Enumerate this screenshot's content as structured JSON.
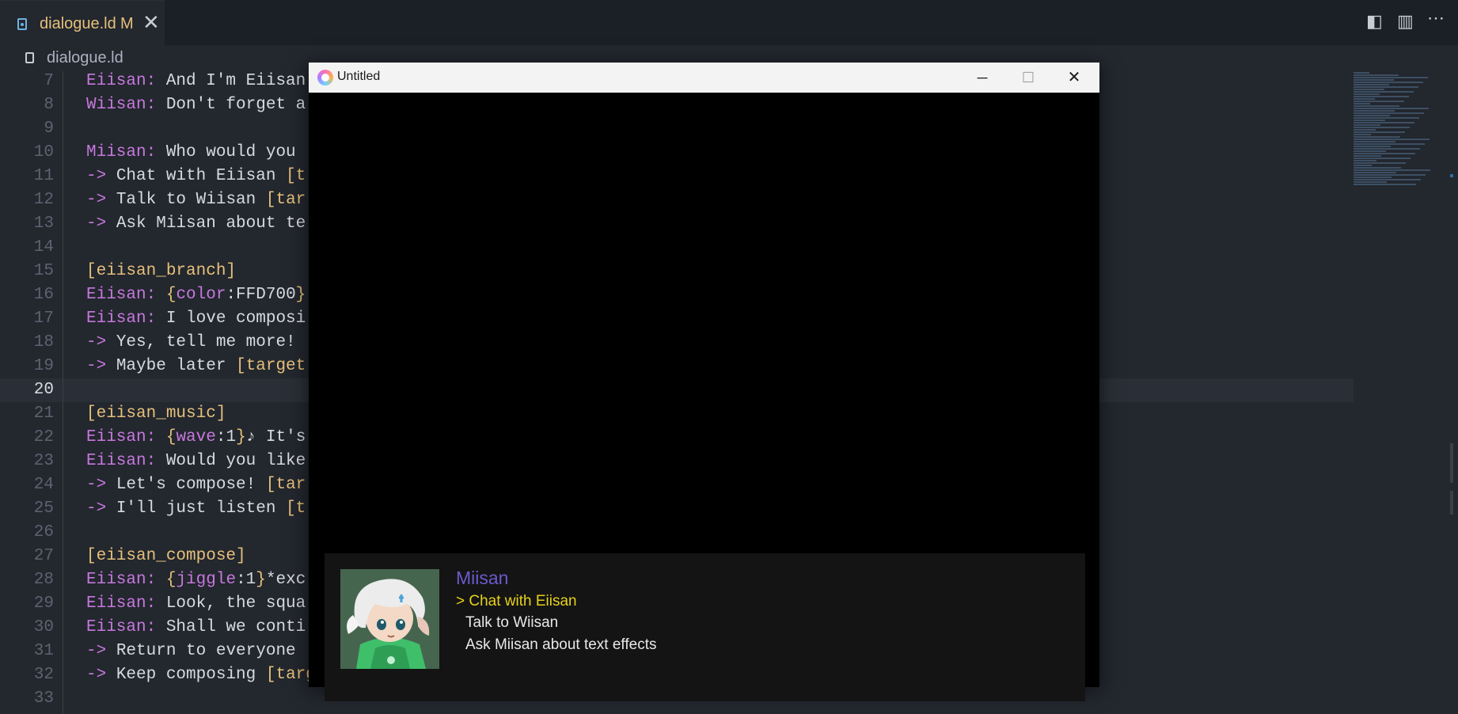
{
  "tab": {
    "filename": "dialogue.ld",
    "modified": "M",
    "close": "✕"
  },
  "breadcrumb": {
    "filename": "dialogue.ld"
  },
  "editor": {
    "lines": [
      {
        "n": "7",
        "parts": [
          [
            "name",
            "Eiisan:"
          ],
          [
            "text",
            " And I'm Eiisan"
          ]
        ]
      },
      {
        "n": "8",
        "parts": [
          [
            "name",
            "Wiisan:"
          ],
          [
            "text",
            " Don't forget a"
          ]
        ]
      },
      {
        "n": "9",
        "parts": []
      },
      {
        "n": "10",
        "parts": [
          [
            "name",
            "Miisan:"
          ],
          [
            "text",
            " Who would you"
          ]
        ]
      },
      {
        "n": "11",
        "parts": [
          [
            "arrow",
            "->"
          ],
          [
            "text",
            " Chat with Eiisan "
          ],
          [
            "br",
            "[t"
          ]
        ]
      },
      {
        "n": "12",
        "parts": [
          [
            "arrow",
            "->"
          ],
          [
            "text",
            " Talk to Wiisan "
          ],
          [
            "br",
            "[tar"
          ]
        ]
      },
      {
        "n": "13",
        "parts": [
          [
            "arrow",
            "->"
          ],
          [
            "text",
            " Ask Miisan about te"
          ]
        ]
      },
      {
        "n": "14",
        "parts": []
      },
      {
        "n": "15",
        "parts": [
          [
            "br",
            "[eiisan_branch]"
          ]
        ]
      },
      {
        "n": "16",
        "parts": [
          [
            "name",
            "Eiisan:"
          ],
          [
            "text",
            " "
          ],
          [
            "br",
            "{"
          ],
          [
            "name",
            "color"
          ],
          [
            "text",
            ":FFD700"
          ],
          [
            "br",
            "}"
          ]
        ]
      },
      {
        "n": "17",
        "parts": [
          [
            "name",
            "Eiisan:"
          ],
          [
            "text",
            " I love composi"
          ]
        ]
      },
      {
        "n": "18",
        "parts": [
          [
            "arrow",
            "->"
          ],
          [
            "text",
            " Yes, tell me more!"
          ]
        ]
      },
      {
        "n": "19",
        "parts": [
          [
            "arrow",
            "->"
          ],
          [
            "text",
            " Maybe later "
          ],
          [
            "br",
            "[target"
          ]
        ]
      },
      {
        "n": "20",
        "parts": [],
        "active": true
      },
      {
        "n": "21",
        "parts": [
          [
            "br",
            "[eiisan_music]"
          ]
        ]
      },
      {
        "n": "22",
        "parts": [
          [
            "name",
            "Eiisan:"
          ],
          [
            "text",
            " "
          ],
          [
            "br",
            "{"
          ],
          [
            "name",
            "wave"
          ],
          [
            "text",
            ":1"
          ],
          [
            "br",
            "}"
          ],
          [
            "text",
            "♪ It's"
          ]
        ]
      },
      {
        "n": "23",
        "parts": [
          [
            "name",
            "Eiisan:"
          ],
          [
            "text",
            " Would you like"
          ]
        ]
      },
      {
        "n": "24",
        "parts": [
          [
            "arrow",
            "->"
          ],
          [
            "text",
            " Let's compose! "
          ],
          [
            "br",
            "[tar"
          ]
        ]
      },
      {
        "n": "25",
        "parts": [
          [
            "arrow",
            "->"
          ],
          [
            "text",
            " I'll just listen "
          ],
          [
            "br",
            "[t"
          ]
        ]
      },
      {
        "n": "26",
        "parts": []
      },
      {
        "n": "27",
        "parts": [
          [
            "br",
            "[eiisan_compose]"
          ]
        ]
      },
      {
        "n": "28",
        "parts": [
          [
            "name",
            "Eiisan:"
          ],
          [
            "text",
            " "
          ],
          [
            "br",
            "{"
          ],
          [
            "name",
            "jiggle"
          ],
          [
            "text",
            ":1"
          ],
          [
            "br",
            "}"
          ],
          [
            "text",
            "*exc"
          ]
        ]
      },
      {
        "n": "29",
        "parts": [
          [
            "name",
            "Eiisan:"
          ],
          [
            "text",
            " Look, the squa"
          ]
        ]
      },
      {
        "n": "30",
        "parts": [
          [
            "name",
            "Eiisan:"
          ],
          [
            "text",
            " Shall we conti"
          ]
        ]
      },
      {
        "n": "31",
        "parts": [
          [
            "arrow",
            "->"
          ],
          [
            "text",
            " Return to everyone"
          ]
        ]
      },
      {
        "n": "32",
        "parts": [
          [
            "arrow",
            "->"
          ],
          [
            "text",
            " Keep composing "
          ],
          [
            "br",
            "[target:eiisan_compose]"
          ]
        ]
      },
      {
        "n": "33",
        "parts": []
      }
    ]
  },
  "window": {
    "title": "Untitled",
    "minimize": "─",
    "maximize": "☐",
    "close": "✕"
  },
  "dialog": {
    "speaker": "Miisan",
    "choices": [
      {
        "label": "> Chat with Eiisan",
        "selected": true
      },
      {
        "label": "Talk to Wiisan",
        "selected": false
      },
      {
        "label": "Ask Miisan about text effects",
        "selected": false
      }
    ]
  },
  "colors": {
    "speaker": "#6a5acd",
    "selected_choice": "#e6d21a",
    "choice": "#e8e8e8"
  }
}
